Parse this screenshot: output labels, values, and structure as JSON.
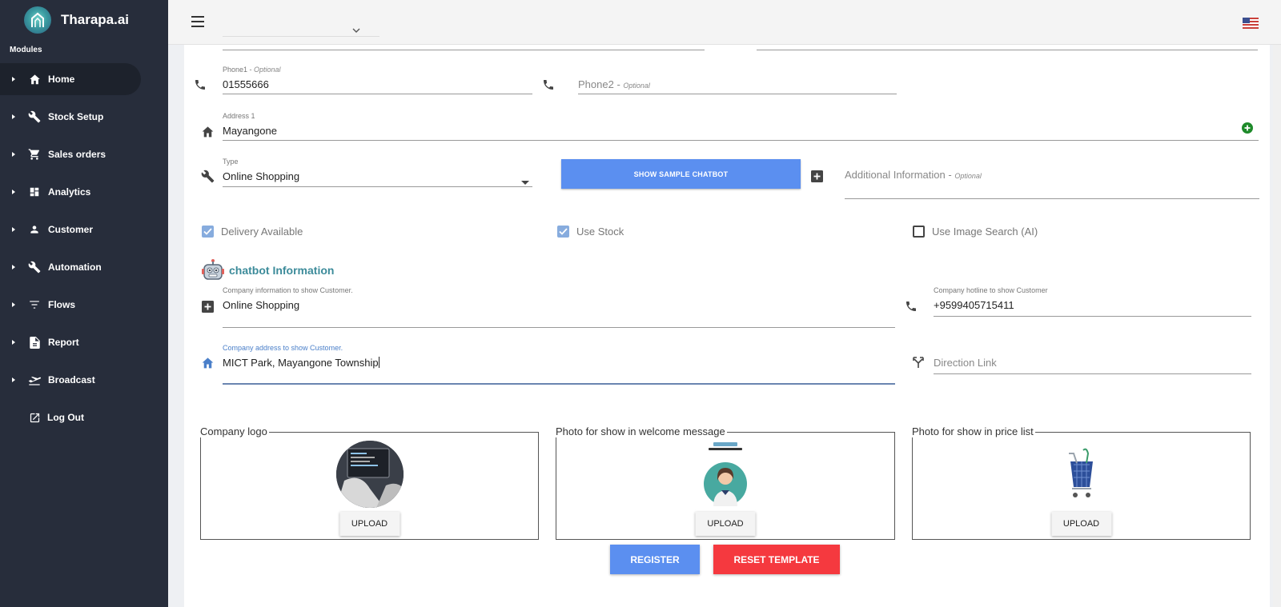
{
  "app": {
    "title": "Tharapa.ai",
    "modules_label": "Modules"
  },
  "sidebar": {
    "items": [
      {
        "label": "Home",
        "icon": "home-icon"
      },
      {
        "label": "Stock Setup",
        "icon": "wrench-icon"
      },
      {
        "label": "Sales orders",
        "icon": "cart-icon"
      },
      {
        "label": "Analytics",
        "icon": "dashboard-icon"
      },
      {
        "label": "Customer",
        "icon": "person-icon"
      },
      {
        "label": "Automation",
        "icon": "wrench-icon"
      },
      {
        "label": "Flows",
        "icon": "filter-icon"
      },
      {
        "label": "Report",
        "icon": "document-icon"
      },
      {
        "label": "Broadcast",
        "icon": "broadcast-icon"
      }
    ],
    "logout": "Log Out"
  },
  "form": {
    "phone1": {
      "label": "Phone1",
      "optional": "Optional",
      "value": "01555666"
    },
    "phone2": {
      "placeholder": "Phone2",
      "optional": "Optional"
    },
    "address1": {
      "label": "Address 1",
      "value": "Mayangone"
    },
    "type": {
      "label": "Type",
      "value": "Online Shopping"
    },
    "sample_button": "SHOW SAMPLE CHATBOT",
    "additional": {
      "placeholder": "Additional Information",
      "optional": "Optional"
    },
    "checks": [
      {
        "label": "Delivery Available",
        "checked": true
      },
      {
        "label": "Use Stock",
        "checked": true
      },
      {
        "label": "Use Image Search (AI)",
        "checked": false
      }
    ],
    "chatbot_title": "chatbot Information",
    "company_info": {
      "label": "Company information to show Customer.",
      "value": "Online Shopping"
    },
    "hotline": {
      "label": "Company hotline to show Customer",
      "value": "+9599405715411"
    },
    "company_address": {
      "label": "Company address to show Customer.",
      "value": "MICT Park, Mayangone Township"
    },
    "direction": {
      "placeholder": "Direction Link"
    }
  },
  "uploads": [
    {
      "legend": "Company logo",
      "button": "UPLOAD"
    },
    {
      "legend": "Photo for show in welcome message",
      "button": "UPLOAD"
    },
    {
      "legend": "Photo for show in price list",
      "button": "UPLOAD"
    }
  ],
  "actions": {
    "register": "REGISTER",
    "reset": "RESET TEMPLATE"
  },
  "colors": {
    "sidebar": "#272d3b",
    "primary": "#5b8ff0",
    "danger": "#f5393f",
    "accent_title": "#3c8b9a",
    "add_green": "#1e8a2a"
  }
}
